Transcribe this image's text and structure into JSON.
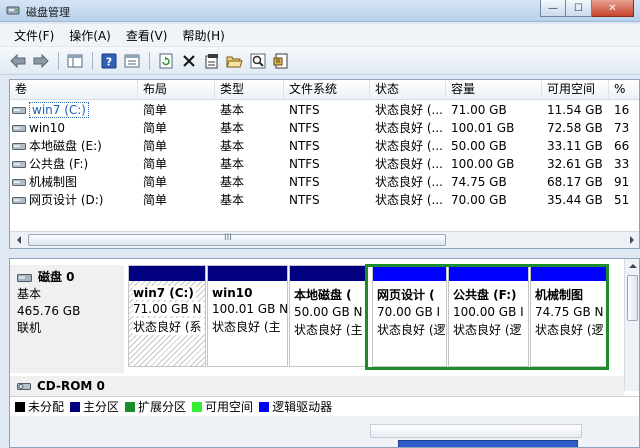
{
  "window": {
    "title": "磁盘管理",
    "min_glyph": "—",
    "max_glyph": "☐",
    "close_glyph": "✕"
  },
  "menu": [
    "文件(F)",
    "操作(A)",
    "查看(V)",
    "帮助(H)"
  ],
  "toolbar": [
    "back-arrow-icon",
    "forward-arrow-icon",
    "console-tree-icon",
    "help-icon",
    "properties-icon",
    "refresh-icon",
    "delete-icon",
    "settings-icon",
    "open-folder-icon",
    "search-icon",
    "export-icon"
  ],
  "columns": [
    "卷",
    "布局",
    "类型",
    "文件系统",
    "状态",
    "容量",
    "可用空间",
    "%"
  ],
  "volumes": [
    {
      "name": "win7 (C:)",
      "layout": "简单",
      "type": "基本",
      "fs": "NTFS",
      "status": "状态良好 (...",
      "capacity": "71.00 GB",
      "free": "11.54 GB",
      "pct": "16"
    },
    {
      "name": "win10",
      "layout": "简单",
      "type": "基本",
      "fs": "NTFS",
      "status": "状态良好 (...",
      "capacity": "100.01 GB",
      "free": "72.58 GB",
      "pct": "73"
    },
    {
      "name": "本地磁盘 (E:)",
      "layout": "简单",
      "type": "基本",
      "fs": "NTFS",
      "status": "状态良好 (...",
      "capacity": "50.00 GB",
      "free": "33.11 GB",
      "pct": "66"
    },
    {
      "name": "公共盘 (F:)",
      "layout": "简单",
      "type": "基本",
      "fs": "NTFS",
      "status": "状态良好 (...",
      "capacity": "100.00 GB",
      "free": "32.61 GB",
      "pct": "33"
    },
    {
      "name": "机械制图",
      "layout": "简单",
      "type": "基本",
      "fs": "NTFS",
      "status": "状态良好 (...",
      "capacity": "74.75 GB",
      "free": "68.17 GB",
      "pct": "91"
    },
    {
      "name": "网页设计 (D:)",
      "layout": "简单",
      "type": "基本",
      "fs": "NTFS",
      "status": "状态良好 (...",
      "capacity": "70.00 GB",
      "free": "35.44 GB",
      "pct": "51"
    }
  ],
  "disk0": {
    "name": "磁盘 0",
    "kind": "基本",
    "size": "465.76 GB",
    "state": "联机",
    "partitions": [
      {
        "name": "win7 (C:)",
        "size": "71.00 GB N",
        "status": "状态良好 (系",
        "bar": "#000080"
      },
      {
        "name": "win10",
        "size": "100.01 GB N",
        "status": "状态良好 (主",
        "bar": "#000080"
      },
      {
        "name": "本地磁盘 (",
        "size": "50.00 GB N",
        "status": "状态良好 (主",
        "bar": "#000080"
      },
      {
        "name": "网页设计 (",
        "size": "70.00 GB I",
        "status": "状态良好 (逻",
        "bar": "#0000ff"
      },
      {
        "name": "公共盘 (F:)",
        "size": "100.00 GB I",
        "status": "状态良好 (逻",
        "bar": "#0000ff"
      },
      {
        "name": "机械制图",
        "size": "74.75 GB N",
        "status": "状态良好 (逻",
        "bar": "#0000ff"
      }
    ]
  },
  "cdrom": {
    "name": "CD-ROM 0"
  },
  "legend": [
    {
      "label": "未分配",
      "color": "#000000"
    },
    {
      "label": "主分区",
      "color": "#000080"
    },
    {
      "label": "扩展分区",
      "color": "#198c2b"
    },
    {
      "label": "可用空间",
      "color": "#33ee33"
    },
    {
      "label": "逻辑驱动器",
      "color": "#0000ff"
    }
  ],
  "scrollbar": {
    "grip": "III"
  }
}
